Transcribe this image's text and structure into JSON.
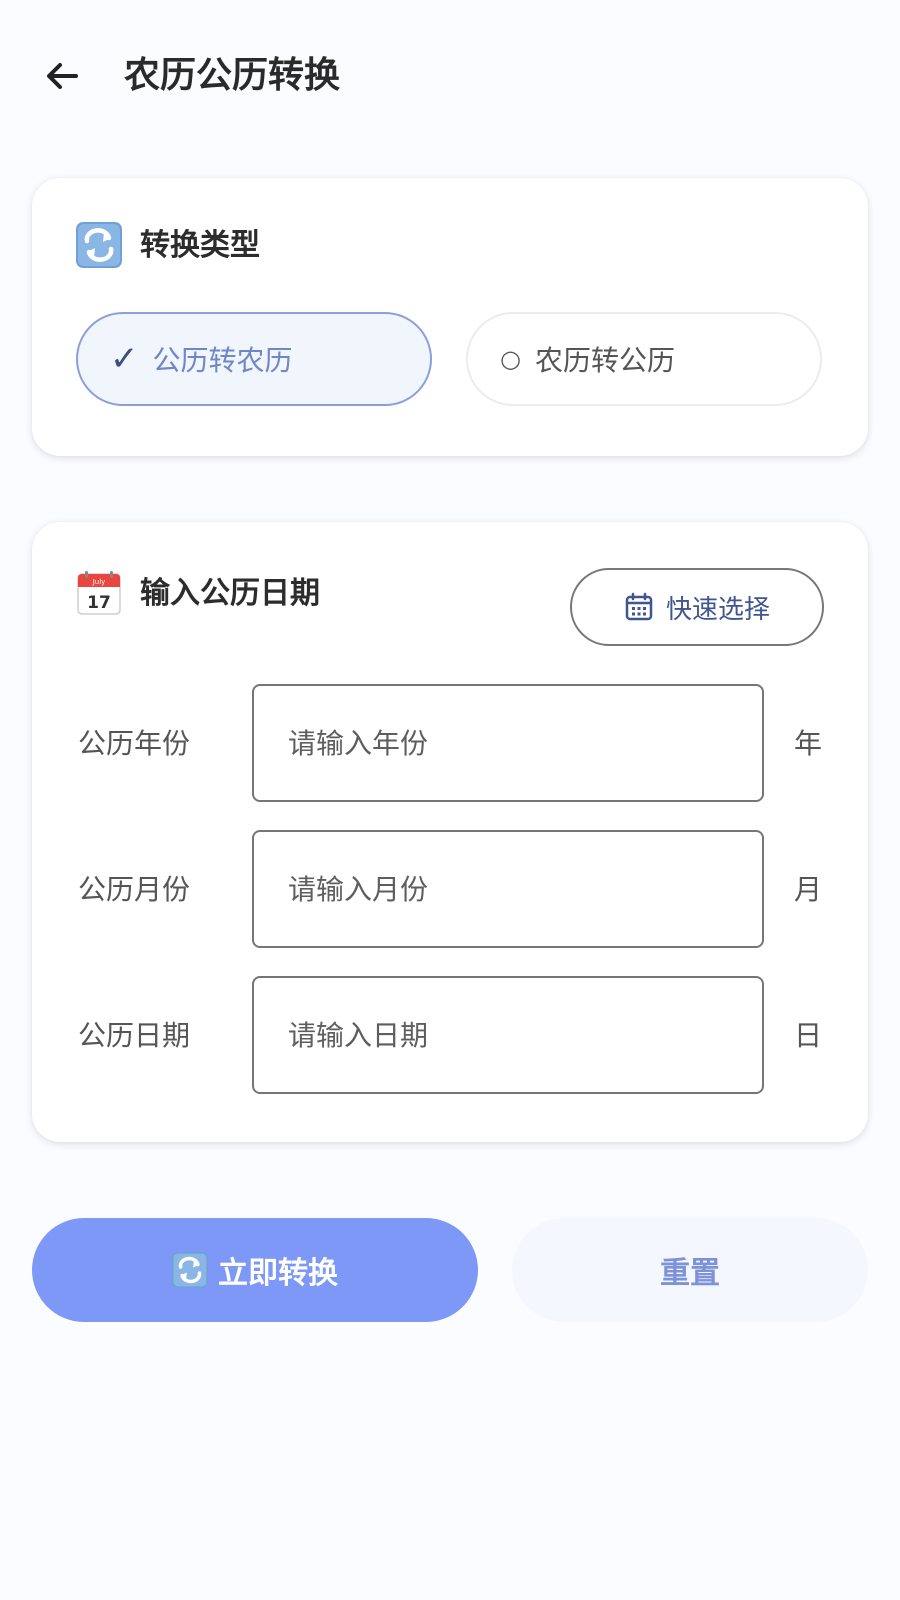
{
  "header": {
    "title": "农历公历转换"
  },
  "conversion_type": {
    "title": "转换类型",
    "options": [
      {
        "mark": "✓",
        "label": "公历转农历",
        "selected": true
      },
      {
        "mark": "○",
        "label": "农历转公历",
        "selected": false
      }
    ]
  },
  "date_input": {
    "title": "输入公历日期",
    "calendar_icon_month": "July",
    "calendar_icon_day": "17",
    "quick_select_label": "快速选择",
    "fields": [
      {
        "label": "公历年份",
        "placeholder": "请输入年份",
        "value": "",
        "unit": "年"
      },
      {
        "label": "公历月份",
        "placeholder": "请输入月份",
        "value": "",
        "unit": "月"
      },
      {
        "label": "公历日期",
        "placeholder": "请输入日期",
        "value": "",
        "unit": "日"
      }
    ]
  },
  "actions": {
    "convert_label": "立即转换",
    "reset_label": "重置"
  },
  "colors": {
    "accent": "#7d98f7",
    "selected_border": "#8a9ee0",
    "selected_bg": "#f1f6fd",
    "reset_text": "#7d92d8"
  }
}
